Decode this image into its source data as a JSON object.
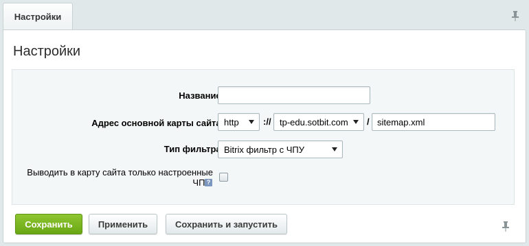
{
  "tab": {
    "label": "Настройки"
  },
  "page_title": "Настройки",
  "form": {
    "name": {
      "label": "Название:",
      "value": "",
      "placeholder": ""
    },
    "sitemap_address": {
      "label": "Адрес основной карты сайта:",
      "protocol": "http",
      "separator_protocol": "://",
      "domain": "tp-edu.sotbit.com",
      "separator_path": "/",
      "filename": "sitemap.xml"
    },
    "filter_type": {
      "label": "Тип фильтра:",
      "value": "Bitrix фильтр с ЧПУ"
    },
    "only_configured": {
      "label_line1": "Выводить в карту сайта только настроенные",
      "label_line2": "ЧПУ:",
      "help_glyph": "?",
      "checked": false
    }
  },
  "buttons": {
    "save": "Сохранить",
    "apply": "Применить",
    "save_and_run": "Сохранить и запустить"
  },
  "colors": {
    "primary_button": "#7ab621",
    "background": "#e0e8ea",
    "form_area": "#f4f7f7"
  },
  "icons": {
    "pin": "pin-icon",
    "help": "help-icon",
    "dropdown": "chevron-down-icon"
  }
}
